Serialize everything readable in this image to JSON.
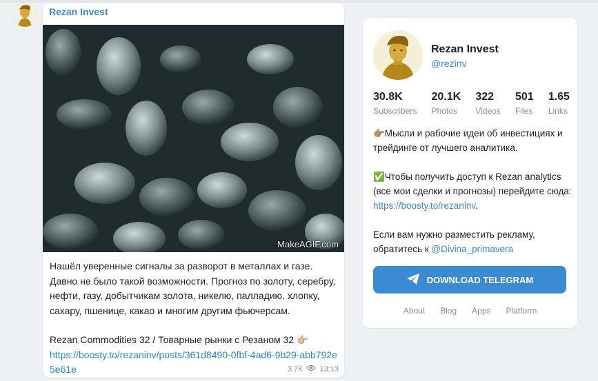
{
  "post": {
    "author": "Rezan Invest",
    "watermark": "MakeAGIF.com",
    "paragraph1": "Нашёл уверенные сигналы за разворот в металлах и газе. Давно не было такой возможности. Прогноз по золоту, серебру, нефти, газу, добытчикам золота, никелю, палладию, хлопку, сахару, пшенице, какао и многим другим фьючерсам.",
    "paragraph2": "Rezan Commodities 32 / Товарные рынки с Резаном 32 👉🏼",
    "link": "https://boosty.to/rezaninv/posts/361d8490-0fbf-4ad6-9b29-abb792e5e61e",
    "views": "3.7K",
    "time": "13:13"
  },
  "channel": {
    "name": "Rezan Invest",
    "handle": "@rezinv",
    "stats": [
      {
        "value": "30.8K",
        "label": "Subscribers"
      },
      {
        "value": "20.1K",
        "label": "Photos"
      },
      {
        "value": "322",
        "label": "Videos"
      },
      {
        "value": "501",
        "label": "Files"
      },
      {
        "value": "1.65",
        "label": "Links"
      }
    ],
    "desc1": "👉🏽Мысли и рабочие идеи об инвестициях и трейдинге от лучшего аналитика.",
    "desc2_prefix": "✅Чтобы получить доступ к Rezan analytics (все мои сделки и прогнозы) перейдите сюда: ",
    "desc2_link": "https://boosty.to/rezaninv",
    "desc2_suffix": ".",
    "desc3_prefix": "Если вам нужно разместить рекламу, обратитесь к ",
    "desc3_link": "@Divina_primavera",
    "download_label": "DOWNLOAD TELEGRAM",
    "footer_links": [
      "About",
      "Blog",
      "Apps",
      "Platform"
    ]
  },
  "colors": {
    "accent": "#3a8bd1",
    "background": "#eef1f4",
    "muted": "#8a8f95"
  }
}
